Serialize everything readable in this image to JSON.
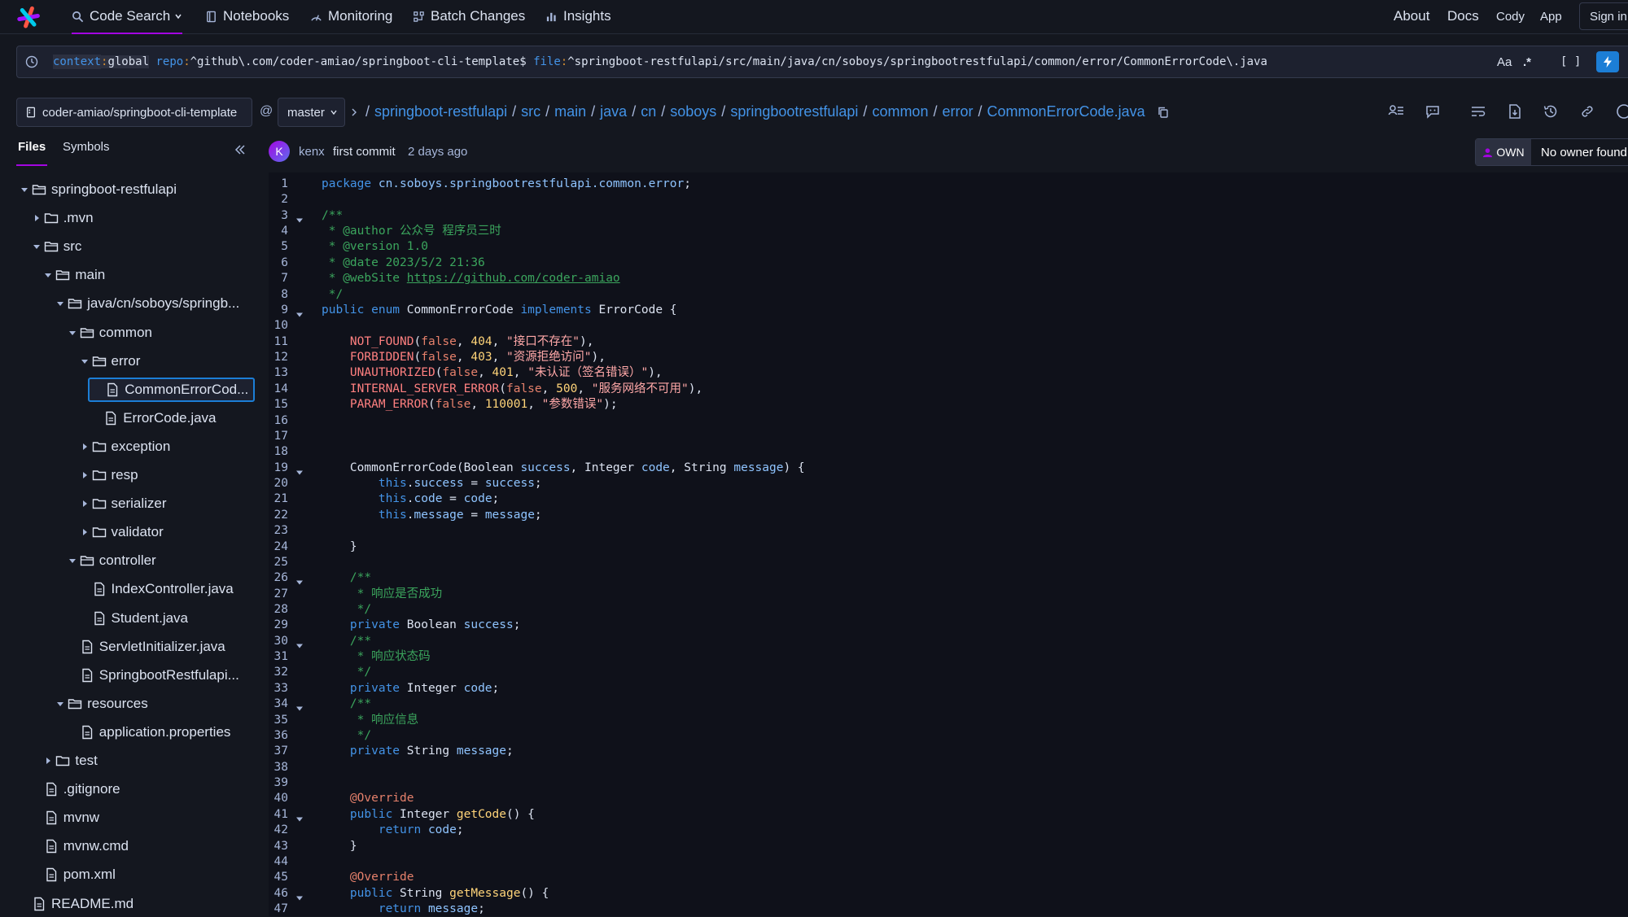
{
  "colors": {
    "accent": "#a305e1",
    "link": "#4393e7",
    "bg": "#14171f",
    "code_bg": "#0f111a",
    "primary": "#1c7ed6"
  },
  "nav": {
    "items": [
      {
        "label": "Code Search",
        "icon": "search-icon"
      },
      {
        "label": "Notebooks",
        "icon": "notebook-icon"
      },
      {
        "label": "Monitoring",
        "icon": "monitoring-icon"
      },
      {
        "label": "Batch Changes",
        "icon": "batch-changes-icon"
      },
      {
        "label": "Insights",
        "icon": "insights-icon"
      }
    ],
    "right": [
      "About",
      "Docs",
      "Cody",
      "App"
    ],
    "sign_in": "Sign in"
  },
  "search": {
    "context_key": "context",
    "context_value": "global",
    "repo_key": "repo",
    "repo_value": "^github\\.com/coder-amiao/springboot-cli-template$",
    "file_key": "file",
    "file_value": "^springboot-restfulapi/src/main/java/cn/soboys/springbootrestfulapi/common/error/CommonErrorCode\\.java",
    "case_toggle": "Aa",
    "regex_toggle": ".*",
    "structural_toggle": "[ ]"
  },
  "repo": {
    "name": "coder-amiao/springboot-cli-template",
    "at": "@",
    "branch": "master",
    "breadcrumb": [
      "springboot-restfulapi",
      "src",
      "main",
      "java",
      "cn",
      "soboys",
      "springbootrestfulapi",
      "common",
      "error",
      "CommonErrorCode.java"
    ]
  },
  "sidebar": {
    "tabs": [
      "Files",
      "Symbols"
    ],
    "tree": [
      {
        "label": "springboot-restfulapi",
        "depth": 0,
        "type": "folder",
        "open": true
      },
      {
        "label": ".mvn",
        "depth": 1,
        "type": "folder",
        "open": false
      },
      {
        "label": "src",
        "depth": 1,
        "type": "folder",
        "open": true
      },
      {
        "label": "main",
        "depth": 2,
        "type": "folder",
        "open": true
      },
      {
        "label": "java/cn/soboys/springb...",
        "depth": 3,
        "type": "folder",
        "open": true
      },
      {
        "label": "common",
        "depth": 4,
        "type": "folder",
        "open": true
      },
      {
        "label": "error",
        "depth": 5,
        "type": "folder",
        "open": true
      },
      {
        "label": "CommonErrorCod...",
        "depth": 6,
        "type": "file",
        "selected": true
      },
      {
        "label": "ErrorCode.java",
        "depth": 6,
        "type": "file"
      },
      {
        "label": "exception",
        "depth": 5,
        "type": "folder",
        "open": false
      },
      {
        "label": "resp",
        "depth": 5,
        "type": "folder",
        "open": false
      },
      {
        "label": "serializer",
        "depth": 5,
        "type": "folder",
        "open": false
      },
      {
        "label": "validator",
        "depth": 5,
        "type": "folder",
        "open": false
      },
      {
        "label": "controller",
        "depth": 4,
        "type": "folder",
        "open": true
      },
      {
        "label": "IndexController.java",
        "depth": 5,
        "type": "file"
      },
      {
        "label": "Student.java",
        "depth": 5,
        "type": "file"
      },
      {
        "label": "ServletInitializer.java",
        "depth": 4,
        "type": "file"
      },
      {
        "label": "SpringbootRestfulapi...",
        "depth": 4,
        "type": "file"
      },
      {
        "label": "resources",
        "depth": 3,
        "type": "folder",
        "open": true
      },
      {
        "label": "application.properties",
        "depth": 4,
        "type": "file"
      },
      {
        "label": "test",
        "depth": 2,
        "type": "folder",
        "open": false
      },
      {
        "label": ".gitignore",
        "depth": 1,
        "type": "file"
      },
      {
        "label": "mvnw",
        "depth": 1,
        "type": "file"
      },
      {
        "label": "mvnw.cmd",
        "depth": 1,
        "type": "file"
      },
      {
        "label": "pom.xml",
        "depth": 1,
        "type": "file"
      },
      {
        "label": "README.md",
        "depth": 0,
        "type": "file"
      }
    ]
  },
  "commit": {
    "avatar": "K",
    "author": "kenx",
    "message": "first commit",
    "time": "2 days ago"
  },
  "ownership": {
    "badge": "OWN",
    "text": "No owner found"
  },
  "code": {
    "folds": [
      3,
      9,
      19,
      26,
      30,
      34,
      41,
      46
    ],
    "lines": [
      [
        [
          "kw",
          "package "
        ],
        [
          "pkg",
          "cn.soboys.springbootrestfulapi.common.error"
        ],
        [
          "plain",
          ";"
        ]
      ],
      [],
      [
        [
          "cm",
          "/**"
        ]
      ],
      [
        [
          "cm",
          " * @author 公众号 程序员三时"
        ]
      ],
      [
        [
          "cm",
          " * @version 1.0"
        ]
      ],
      [
        [
          "cm",
          " * @date 2023/5/2 21:36"
        ]
      ],
      [
        [
          "cm",
          " * @webSite "
        ],
        [
          "link",
          "https://github.com/coder-amiao"
        ]
      ],
      [
        [
          "cm",
          " */"
        ]
      ],
      [
        [
          "kw",
          "public enum "
        ],
        [
          "type",
          "CommonErrorCode "
        ],
        [
          "kw",
          "implements "
        ],
        [
          "type",
          "ErrorCode {"
        ]
      ],
      [],
      [
        [
          "plain",
          "    "
        ],
        [
          "enum",
          "NOT_FOUND"
        ],
        [
          "plain",
          "("
        ],
        [
          "kwv",
          "false"
        ],
        [
          "plain",
          ", "
        ],
        [
          "num",
          "404"
        ],
        [
          "plain",
          ", "
        ],
        [
          "str",
          "\"接口不存在\""
        ],
        [
          "plain",
          "),"
        ]
      ],
      [
        [
          "plain",
          "    "
        ],
        [
          "enum",
          "FORBIDDEN"
        ],
        [
          "plain",
          "("
        ],
        [
          "kwv",
          "false"
        ],
        [
          "plain",
          ", "
        ],
        [
          "num",
          "403"
        ],
        [
          "plain",
          ", "
        ],
        [
          "str",
          "\"资源拒绝访问\""
        ],
        [
          "plain",
          "),"
        ]
      ],
      [
        [
          "plain",
          "    "
        ],
        [
          "enum",
          "UNAUTHORIZED"
        ],
        [
          "plain",
          "("
        ],
        [
          "kwv",
          "false"
        ],
        [
          "plain",
          ", "
        ],
        [
          "num",
          "401"
        ],
        [
          "plain",
          ", "
        ],
        [
          "str",
          "\"未认证（签名错误）\""
        ],
        [
          "plain",
          "),"
        ]
      ],
      [
        [
          "plain",
          "    "
        ],
        [
          "enum",
          "INTERNAL_SERVER_ERROR"
        ],
        [
          "plain",
          "("
        ],
        [
          "kwv",
          "false"
        ],
        [
          "plain",
          ", "
        ],
        [
          "num",
          "500"
        ],
        [
          "plain",
          ", "
        ],
        [
          "str",
          "\"服务网络不可用\""
        ],
        [
          "plain",
          "),"
        ]
      ],
      [
        [
          "plain",
          "    "
        ],
        [
          "enum",
          "PARAM_ERROR"
        ],
        [
          "plain",
          "("
        ],
        [
          "kwv",
          "false"
        ],
        [
          "plain",
          ", "
        ],
        [
          "num",
          "110001"
        ],
        [
          "plain",
          ", "
        ],
        [
          "str",
          "\"参数错误\""
        ],
        [
          "plain",
          ");"
        ]
      ],
      [],
      [],
      [],
      [
        [
          "plain",
          "    "
        ],
        [
          "type",
          "CommonErrorCode(Boolean "
        ],
        [
          "var",
          "success"
        ],
        [
          "plain",
          ", "
        ],
        [
          "type",
          "Integer "
        ],
        [
          "var",
          "code"
        ],
        [
          "plain",
          ", "
        ],
        [
          "type",
          "String "
        ],
        [
          "var",
          "message"
        ],
        [
          "plain",
          ") {"
        ]
      ],
      [
        [
          "plain",
          "        "
        ],
        [
          "kw",
          "this"
        ],
        [
          "plain",
          "."
        ],
        [
          "var",
          "success"
        ],
        [
          "plain",
          " = "
        ],
        [
          "var",
          "success"
        ],
        [
          "plain",
          ";"
        ]
      ],
      [
        [
          "plain",
          "        "
        ],
        [
          "kw",
          "this"
        ],
        [
          "plain",
          "."
        ],
        [
          "var",
          "code"
        ],
        [
          "plain",
          " = "
        ],
        [
          "var",
          "code"
        ],
        [
          "plain",
          ";"
        ]
      ],
      [
        [
          "plain",
          "        "
        ],
        [
          "kw",
          "this"
        ],
        [
          "plain",
          "."
        ],
        [
          "var",
          "message"
        ],
        [
          "plain",
          " = "
        ],
        [
          "var",
          "message"
        ],
        [
          "plain",
          ";"
        ]
      ],
      [],
      [
        [
          "plain",
          "    }"
        ]
      ],
      [],
      [
        [
          "cm",
          "    /**"
        ]
      ],
      [
        [
          "cm",
          "     * 响应是否成功"
        ]
      ],
      [
        [
          "cm",
          "     */"
        ]
      ],
      [
        [
          "plain",
          "    "
        ],
        [
          "kw",
          "private "
        ],
        [
          "type",
          "Boolean "
        ],
        [
          "var",
          "success"
        ],
        [
          "plain",
          ";"
        ]
      ],
      [
        [
          "cm",
          "    /**"
        ]
      ],
      [
        [
          "cm",
          "     * 响应状态码"
        ]
      ],
      [
        [
          "cm",
          "     */"
        ]
      ],
      [
        [
          "plain",
          "    "
        ],
        [
          "kw",
          "private "
        ],
        [
          "type",
          "Integer "
        ],
        [
          "var",
          "code"
        ],
        [
          "plain",
          ";"
        ]
      ],
      [
        [
          "cm",
          "    /**"
        ]
      ],
      [
        [
          "cm",
          "     * 响应信息"
        ]
      ],
      [
        [
          "cm",
          "     */"
        ]
      ],
      [
        [
          "plain",
          "    "
        ],
        [
          "kw",
          "private "
        ],
        [
          "type",
          "String "
        ],
        [
          "var",
          "message"
        ],
        [
          "plain",
          ";"
        ]
      ],
      [],
      [],
      [
        [
          "plain",
          "    "
        ],
        [
          "ann",
          "@Override"
        ]
      ],
      [
        [
          "plain",
          "    "
        ],
        [
          "kw",
          "public "
        ],
        [
          "type",
          "Integer "
        ],
        [
          "fn",
          "getCode"
        ],
        [
          "plain",
          "() {"
        ]
      ],
      [
        [
          "plain",
          "        "
        ],
        [
          "kw",
          "return "
        ],
        [
          "var",
          "code"
        ],
        [
          "plain",
          ";"
        ]
      ],
      [
        [
          "plain",
          "    }"
        ]
      ],
      [],
      [
        [
          "plain",
          "    "
        ],
        [
          "ann",
          "@Override"
        ]
      ],
      [
        [
          "plain",
          "    "
        ],
        [
          "kw",
          "public "
        ],
        [
          "type",
          "String "
        ],
        [
          "fn",
          "getMessage"
        ],
        [
          "plain",
          "() {"
        ]
      ],
      [
        [
          "plain",
          "        "
        ],
        [
          "kw",
          "return "
        ],
        [
          "var",
          "message"
        ],
        [
          "plain",
          ";"
        ]
      ]
    ]
  }
}
